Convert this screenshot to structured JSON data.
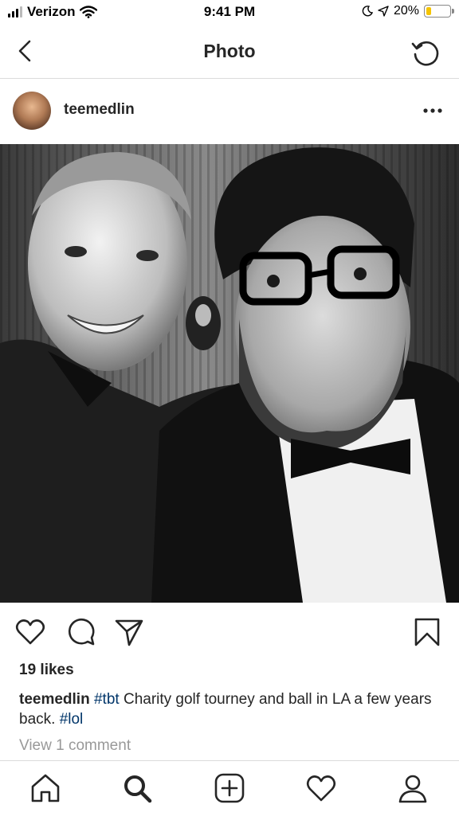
{
  "status_bar": {
    "carrier": "Verizon",
    "time": "9:41 PM",
    "battery_percent": "20%",
    "battery_level": 0.2,
    "battery_color": "#f5c400"
  },
  "nav": {
    "title": "Photo",
    "back_icon": "chevron-left-icon",
    "refresh_icon": "refresh-icon"
  },
  "post": {
    "username": "teemedlin",
    "more_icon": "ellipsis-icon",
    "likes": "19 likes",
    "caption": {
      "username": "teemedlin",
      "hashtag1": "#tbt",
      "text": " Charity golf tourney and ball in LA a few years back. ",
      "hashtag2": "#lol"
    },
    "view_comments": "View 1 comment"
  },
  "actions": [
    "heart-icon",
    "comment-icon",
    "share-icon",
    "bookmark-icon"
  ],
  "tab_bar": [
    "home-icon",
    "search-icon",
    "add-icon",
    "activity-icon",
    "profile-icon"
  ],
  "colors": {
    "text": "#262626",
    "hashtag": "#003569",
    "muted": "#999999",
    "divider": "#dbdbdb"
  }
}
